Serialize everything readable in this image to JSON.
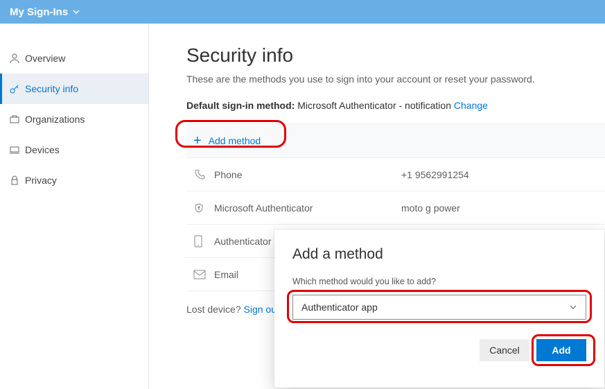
{
  "header": {
    "title": "My Sign-Ins"
  },
  "sidebar": {
    "items": [
      {
        "label": "Overview",
        "icon": "person-icon"
      },
      {
        "label": "Security info",
        "icon": "key-icon"
      },
      {
        "label": "Organizations",
        "icon": "org-icon"
      },
      {
        "label": "Devices",
        "icon": "device-icon"
      },
      {
        "label": "Privacy",
        "icon": "lock-icon"
      }
    ]
  },
  "page": {
    "title": "Security info",
    "subtitle": "These are the methods you use to sign into your account or reset your password.",
    "default_label": "Default sign-in method:",
    "default_value": "Microsoft Authenticator - notification",
    "change_label": "Change",
    "add_method_label": "Add method",
    "lost_prefix": "Lost device? ",
    "lost_link": "Sign out e"
  },
  "methods": [
    {
      "name": "Phone",
      "value": "+1 9562991254",
      "icon": "phone-icon"
    },
    {
      "name": "Microsoft Authenticator",
      "value": "moto g power",
      "icon": "shield-icon"
    },
    {
      "name": "Authenticator app",
      "value": "",
      "icon": "mobile-icon"
    },
    {
      "name": "Email",
      "value": "",
      "icon": "email-icon"
    }
  ],
  "dialog": {
    "title": "Add a method",
    "question": "Which method would you like to add?",
    "selected": "Authenticator app",
    "cancel": "Cancel",
    "add": "Add"
  }
}
